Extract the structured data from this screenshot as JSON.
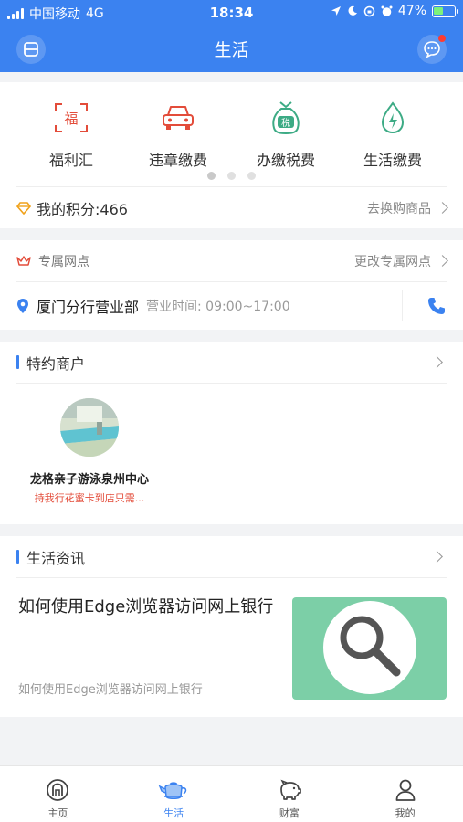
{
  "status_bar": {
    "carrier": "中国移动",
    "network": "4G",
    "time": "18:34",
    "battery": "47%",
    "battery_level": 0.47
  },
  "header": {
    "title": "生活"
  },
  "quick_actions": [
    {
      "label": "福利汇",
      "icon": "fu-icon"
    },
    {
      "label": "违章缴费",
      "icon": "car-icon"
    },
    {
      "label": "办缴税费",
      "icon": "tax-bag-icon"
    },
    {
      "label": "生活缴费",
      "icon": "water-drop-icon"
    }
  ],
  "pager": {
    "pages": 3,
    "current": 1
  },
  "points": {
    "label": "我的积分:466",
    "link": "去换购商品"
  },
  "branch": {
    "title": "专属网点",
    "change_link": "更改专属网点",
    "name": "厦门分行营业部",
    "hours": "营业时间: 09:00~17:00"
  },
  "merchants": {
    "title": "特约商户",
    "items": [
      {
        "name": "龙格亲子游泳泉州中心",
        "desc": "持我行花蜜卡到店只需..."
      }
    ]
  },
  "news": {
    "title": "生活资讯",
    "headline": "如何使用Edge浏览器访问网上银行",
    "desc": "如何使用Edge浏览器访问网上银行"
  },
  "tabs": [
    {
      "label": "主页",
      "icon": "home-icon"
    },
    {
      "label": "生活",
      "icon": "teapot-icon",
      "active": true
    },
    {
      "label": "财富",
      "icon": "piggy-bank-icon"
    },
    {
      "label": "我的",
      "icon": "person-icon"
    }
  ],
  "colors": {
    "primary": "#3b82f0",
    "red": "#e34c3a",
    "green": "#3dab85"
  }
}
